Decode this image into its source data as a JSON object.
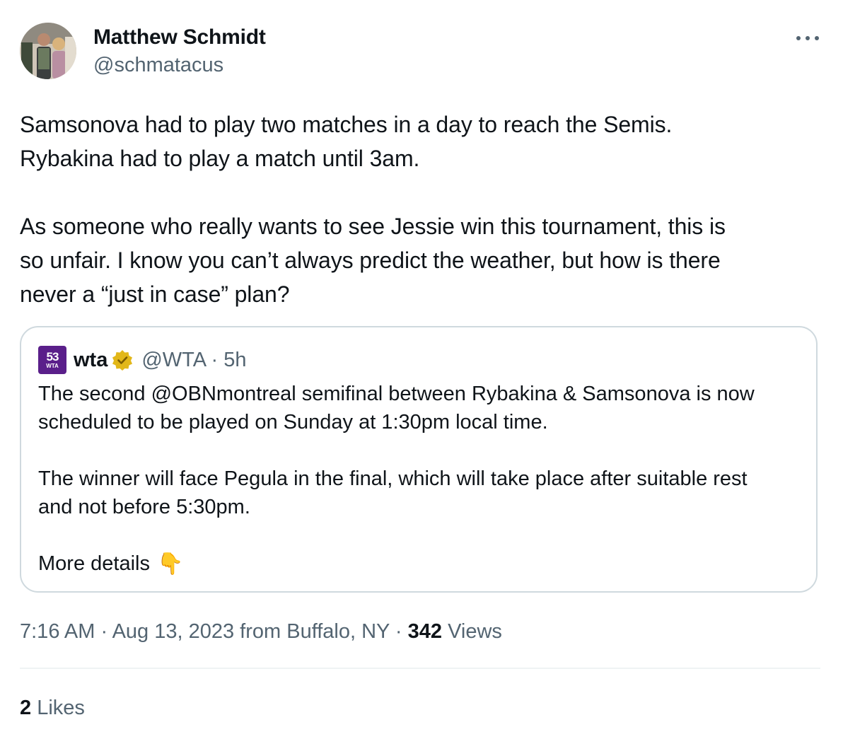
{
  "author": {
    "display_name": "Matthew Schmidt",
    "handle": "@schmatacus",
    "avatar_icon": "profile-photo"
  },
  "more_icon": "ellipsis-icon",
  "tweet_text": {
    "line1": "Samsonova had to play two matches in a day to reach the Semis.",
    "line2": "Rybakina had to play a match until 3am.",
    "line3": "As someone who really wants to see Jessie win this tournament, this is",
    "line4": "so unfair. I know you can’t always predict the weather, but how is there",
    "line5": "never a “just in case” plan?"
  },
  "quoted": {
    "logo_big": "53",
    "logo_small": "WTA",
    "name": "wta",
    "verified_icon": "gold-verified-badge-icon",
    "handle_time": "@WTA · 5h",
    "line1": "The second @OBNmontreal semifinal between Rybakina & Samsonova is now",
    "line2": "scheduled to be played on Sunday at 1:30pm local time.",
    "line3": "The winner will face Pegula in the final, which will take place after suitable rest",
    "line4": "and not before 5:30pm.",
    "line5": "More details",
    "emoji": "👇"
  },
  "meta": {
    "prefix": "7:16 AM · Aug 13, 2023 from Buffalo, NY · ",
    "views_count": "342",
    "views_label": " Views"
  },
  "likes": {
    "count": "2",
    "label": " Likes"
  },
  "colors": {
    "text_primary": "#0f1419",
    "text_secondary": "#536471",
    "border": "#cfd9de",
    "divider": "#eff3f4",
    "wta_purple": "#5a1f8a",
    "badge_gold": "#e2b719"
  }
}
